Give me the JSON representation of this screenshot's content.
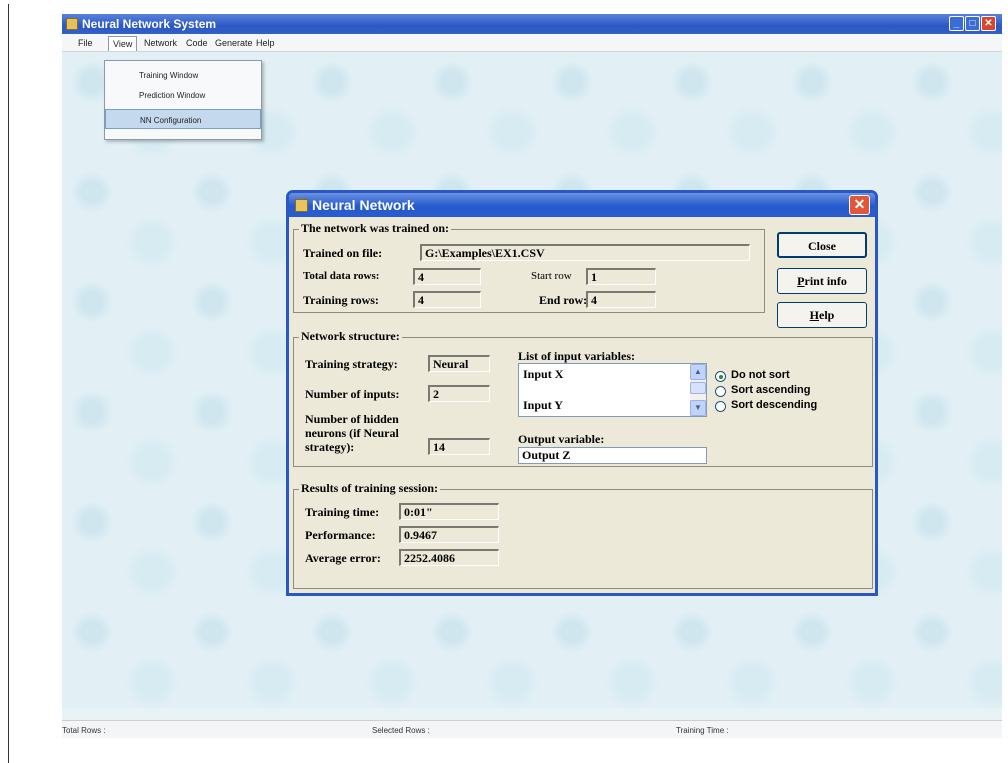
{
  "app": {
    "title": "Neural Network System",
    "menu": [
      "File",
      "View",
      "Network",
      "Code",
      "Generate",
      "Help"
    ],
    "view_menu_items": [
      "Training Window",
      "Prediction Window",
      "NN Configuration"
    ],
    "status": {
      "total_rows": "Total Rows :",
      "selected_rows": "Selected Rows :",
      "training_time": "Training Time :"
    }
  },
  "dialog": {
    "title": "Neural Network",
    "close_glyph": "✕",
    "trained_group": {
      "title": "The network was trained on:",
      "trained_on_file_label": "Trained on file:",
      "trained_on_file_value": "G:\\Examples\\EX1.CSV",
      "total_data_rows_label": "Total data rows:",
      "total_data_rows_value": "4",
      "start_row_label": "Start row",
      "start_row_value": "1",
      "training_rows_label": "Training rows:",
      "training_rows_value": "4",
      "end_row_label": "End row:",
      "end_row_value": "4"
    },
    "buttons": {
      "close": "Close",
      "print_info_pre": "",
      "print_info_key": "P",
      "print_info_post": "rint info",
      "help_key": "H",
      "help_post": "elp"
    },
    "structure_group": {
      "title": "Network structure:",
      "training_strategy_label": "Training strategy:",
      "training_strategy_value": "Neural",
      "number_of_inputs_label": "Number of inputs:",
      "number_of_inputs_value": "2",
      "hidden_label_1": "Number of hidden",
      "hidden_label_2": "neurons (if Neural",
      "hidden_label_3": "strategy):",
      "hidden_value": "14",
      "input_vars_label": "List of input variables:",
      "input_vars": [
        "Input X",
        "Input Y"
      ],
      "output_var_label": "Output variable:",
      "output_var_value": "Output Z",
      "sort_options": [
        "Do not sort",
        "Sort ascending",
        "Sort descending"
      ],
      "sort_selected": "Do not sort"
    },
    "results_group": {
      "title": "Results of training session:",
      "training_time_label": "Training time:",
      "training_time_value": "0:01\"",
      "performance_label": "Performance:",
      "performance_value": "0.9467",
      "average_error_label": "Average error:",
      "average_error_value": "2252.4086"
    }
  }
}
